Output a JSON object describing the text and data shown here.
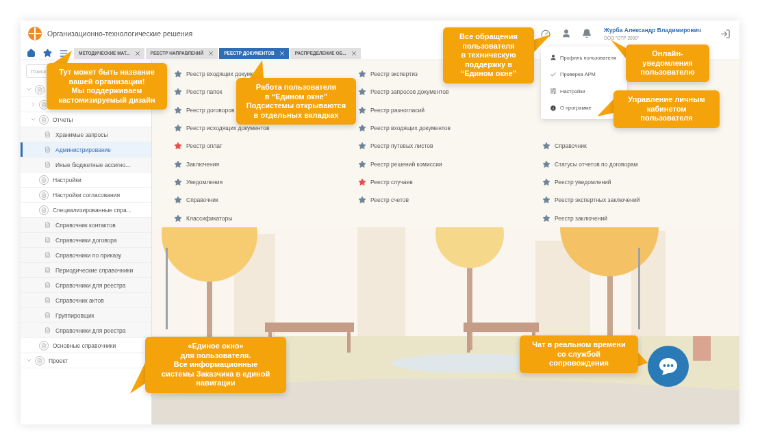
{
  "header": {
    "title": "Организационно-технологические решения",
    "user": {
      "name": "Журба Александр Владимирович",
      "organization": "ООО \"ОТР 2000\""
    }
  },
  "tabs": [
    {
      "label": "МЕТОДИЧЕСКИЕ МАТ...",
      "selected": false
    },
    {
      "label": "РЕЕСТР НАПРАВЛЕНИЙ",
      "selected": false
    },
    {
      "label": "РЕЕСТР ДОКУМЕНТОВ",
      "selected": true
    },
    {
      "label": "РАСПРЕДЕЛЕНИЕ ОБ...",
      "selected": false
    }
  ],
  "sidebar": {
    "search": {
      "placeholder": "Поиск"
    },
    "tree": [
      {
        "expanded": true,
        "selected": false,
        "children": [
          {
            "expanded": false,
            "selected": false
          },
          {
            "label": "Отчеты",
            "expanded": true,
            "selected": false,
            "children": [
              {
                "label": "Хранимые запросы",
                "selected": false
              },
              {
                "label": "Администрирование",
                "selected": true
              },
              {
                "label": "Иные бюджетные ассигно...",
                "selected": false
              }
            ]
          },
          {
            "label": "Настройки",
            "selected": false
          },
          {
            "label": "Настройки согласования",
            "selected": false
          },
          {
            "label": "Специализированные спра...",
            "selected": false,
            "children": [
              {
                "label": "Справочник контактов",
                "selected": false
              },
              {
                "label": "Справочники договора",
                "selected": false
              },
              {
                "label": "Справочники по приказу",
                "selected": false
              },
              {
                "label": "Периодические справочники",
                "selected": false
              },
              {
                "label": "Справочники для реестра",
                "selected": false
              },
              {
                "label": "Справочник актов",
                "selected": false
              },
              {
                "label": "Группировщик",
                "selected": false
              },
              {
                "label": "Справочники для реестра",
                "selected": false
              }
            ]
          },
          {
            "label": "Основные справочники",
            "selected": false
          }
        ]
      },
      {
        "label": "Проект",
        "expanded": true,
        "selected": false
      }
    ]
  },
  "favorites": {
    "columns": [
      {
        "items": [
          {
            "label": "Реестр входящих докуме",
            "favorite": false
          },
          {
            "label": "Реестр папок",
            "favorite": false
          },
          {
            "label": "Реестр договоров",
            "favorite": false
          },
          {
            "label": "Реестр исходящих документов",
            "favorite": false
          },
          {
            "label": "Реестр оплат",
            "favorite": true
          },
          {
            "label": "Заключения",
            "favorite": false
          },
          {
            "label": "Уведомления",
            "favorite": false
          },
          {
            "label": "Справочник",
            "favorite": false
          },
          {
            "label": "Классификаторы",
            "favorite": false
          }
        ]
      },
      {
        "items": [
          {
            "label": "Реестр экспертиз",
            "favorite": false
          },
          {
            "label": "Реестр запросов документов",
            "favorite": false
          },
          {
            "label": "Реестр разногласий",
            "favorite": false
          },
          {
            "label": "Реестр входящих документов",
            "favorite": false
          },
          {
            "label": "Реестр путевых листов",
            "favorite": false
          },
          {
            "label": "Реестр решений комиссии",
            "favorite": false
          },
          {
            "label": "Реестр случаев",
            "favorite": true
          },
          {
            "label": "Реестр счетов",
            "favorite": false
          }
        ]
      },
      {
        "items": [
          {
            "label": "Справочник",
            "favorite": false
          },
          {
            "label": "Статусы отчетов по договорам",
            "favorite": false
          },
          {
            "label": "Реестр уведомлений",
            "favorite": false
          },
          {
            "label": "Реестр экспертных заключений",
            "favorite": false
          },
          {
            "label": "Реестр заключений",
            "favorite": false
          }
        ]
      }
    ]
  },
  "user_menu": [
    {
      "kind": "profile",
      "label": "Профиль пользователя"
    },
    {
      "kind": "check",
      "label": "Проверка АРМ"
    },
    {
      "kind": "settings",
      "label": "Настройки"
    },
    {
      "kind": "info",
      "label": "О программе"
    }
  ],
  "callouts": [
    "Тут может быть название\nвашей организации!\nМы поддерживаем\nкастомизируемый дизайн",
    "Работа пользователя\nв “Едином окне”\nПодсистемы открываются\nв отдельных вкладках",
    "Все обращения\nпользователя\nв техническую\nподдержку в\n“Едином окне”",
    "Онлайн-\nуведомления\nпользователю",
    "Управление личным\nкабинетом\nпользователя",
    "«Единое окно»\nдля пользователя.\nВсе информационные\nсистемы Заказчика в единой\nнавигации",
    "Чат в реальном времени\nсо службой\nсопровождения"
  ]
}
